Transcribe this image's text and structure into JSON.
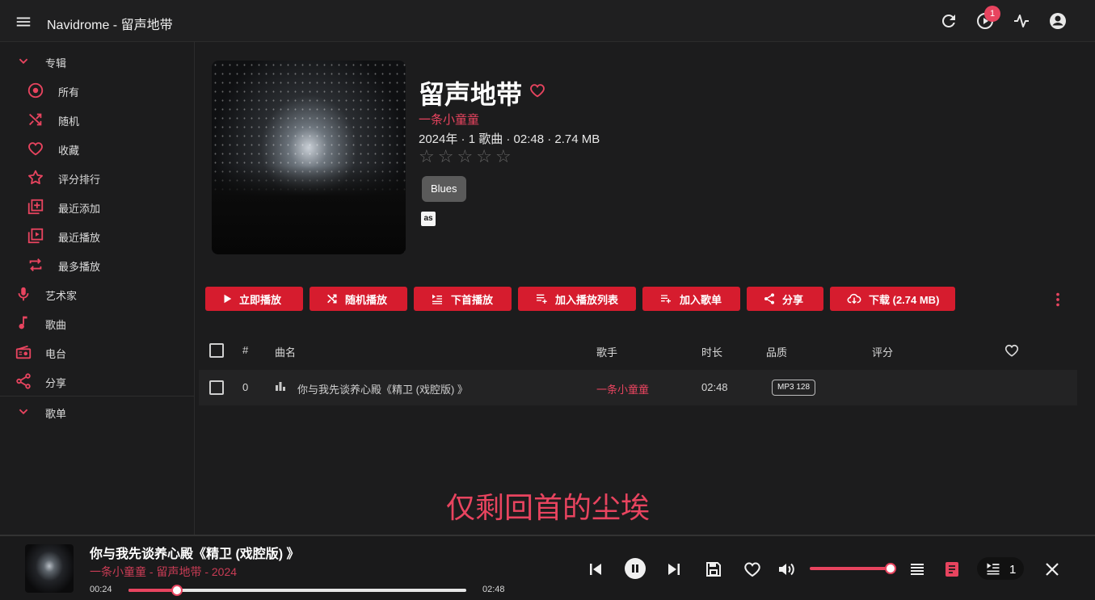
{
  "app": {
    "title": "Navidrome - 留声地带",
    "queue_badge": "1"
  },
  "colors": {
    "accent": "#e8445f",
    "button": "#d61c2e",
    "background": "#1c1c1d"
  },
  "top_icons": [
    "hamburger-icon",
    "refresh-icon",
    "play-queue-icon",
    "activity-icon",
    "account-icon"
  ],
  "sidebar": {
    "sections": [
      {
        "label": "专辑"
      },
      {
        "label": "歌单"
      }
    ],
    "items": [
      {
        "label": "所有",
        "icon": "disc-icon"
      },
      {
        "label": "随机",
        "icon": "shuffle-icon"
      },
      {
        "label": "收藏",
        "icon": "heart-icon"
      },
      {
        "label": "评分排行",
        "icon": "star-icon"
      },
      {
        "label": "最近添加",
        "icon": "library-add-icon"
      },
      {
        "label": "最近播放",
        "icon": "video-library-icon"
      },
      {
        "label": "最多播放",
        "icon": "repeat-icon"
      },
      {
        "label": "艺术家",
        "icon": "mic-icon"
      },
      {
        "label": "歌曲",
        "icon": "music-note-icon"
      },
      {
        "label": "电台",
        "icon": "radio-icon"
      },
      {
        "label": "分享",
        "icon": "share-icon"
      }
    ]
  },
  "album": {
    "title": "留声地带",
    "artist": "一条小童童",
    "meta": "2024年 · 1 歌曲 · 02:48 · 2.74 MB",
    "rating": 0,
    "rating_max": 5,
    "genre": "Blues",
    "lastfm_label": "as"
  },
  "actions": [
    {
      "label": "立即播放",
      "icon": "play-icon"
    },
    {
      "label": "随机播放",
      "icon": "shuffle-icon"
    },
    {
      "label": "下首播放",
      "icon": "play-next-icon"
    },
    {
      "label": "加入播放列表",
      "icon": "playlist-add-icon"
    },
    {
      "label": "加入歌单",
      "icon": "playlist-plus-icon"
    },
    {
      "label": "分享",
      "icon": "share-icon"
    },
    {
      "label": "下载 (2.74 MB)",
      "icon": "cloud-download-icon"
    }
  ],
  "table": {
    "headers": {
      "num": "#",
      "title": "曲名",
      "artist": "歌手",
      "duration": "时长",
      "quality": "品质",
      "rating": "评分"
    },
    "rows": [
      {
        "num": "0",
        "title": "你与我先谈养心殿《精卫 (戏腔版) 》",
        "artist": "一条小童童",
        "duration": "02:48",
        "quality": "MP3 128"
      }
    ]
  },
  "lyric": "仅剩回首的尘埃",
  "player": {
    "title": "你与我先谈养心殿《精卫 (戏腔版) 》",
    "subtitle": "一条小童童 - 留声地带 - 2024",
    "elapsed": "00:24",
    "total": "02:48",
    "progress": 0.143,
    "volume": 1.0,
    "queue_count": "1"
  }
}
